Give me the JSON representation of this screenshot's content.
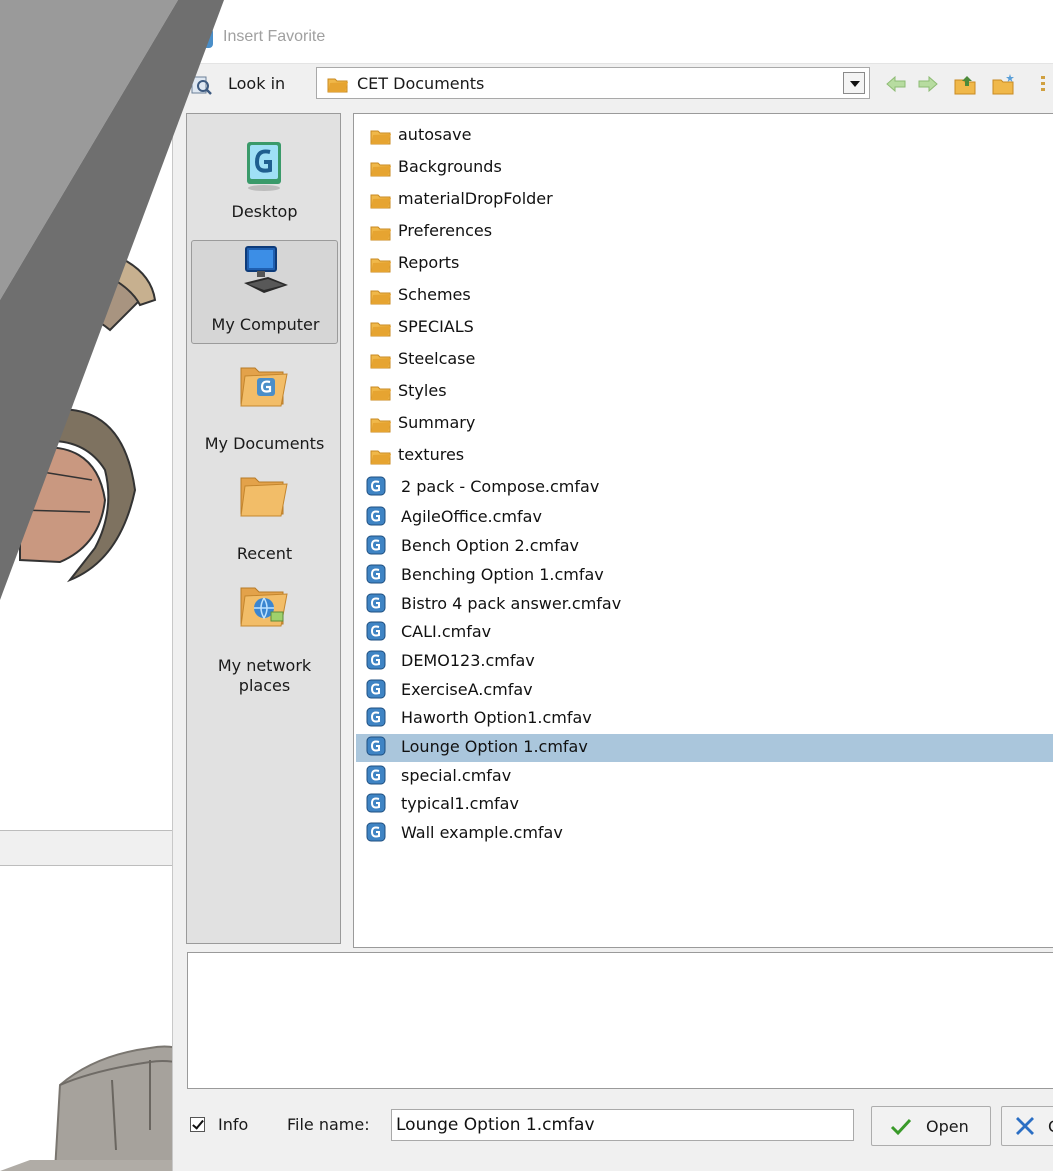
{
  "dialog": {
    "title": "Insert Favorite",
    "look_in_label": "Look in",
    "look_in_value": "CET Documents",
    "toolbar": {
      "back_icon": "arrow-left-icon",
      "forward_icon": "arrow-right-icon",
      "up_icon": "folder-up-icon",
      "new_folder_icon": "new-folder-icon",
      "view_icon": "view-menu-icon"
    }
  },
  "places": [
    {
      "label": "Desktop",
      "icon": "desktop-icon"
    },
    {
      "label": "My Computer",
      "icon": "computer-icon",
      "selected": true
    },
    {
      "label": "My Documents",
      "icon": "documents-folder-icon"
    },
    {
      "label": "Recent",
      "icon": "recent-folder-icon"
    },
    {
      "label": "My network places",
      "icon": "network-folder-icon"
    }
  ],
  "folders": [
    "autosave",
    "Backgrounds",
    "materialDropFolder",
    "Preferences",
    "Reports",
    "Schemes",
    "SPECIALS",
    "Steelcase",
    "Styles",
    "Summary",
    "textures"
  ],
  "files": [
    "2 pack - Compose.cmfav",
    "AgileOffice.cmfav",
    "Bench Option 2.cmfav",
    "Benching Option 1.cmfav",
    "Bistro 4 pack answer.cmfav",
    "CALI.cmfav",
    "DEMO123.cmfav",
    "ExerciseA.cmfav",
    "Haworth Option1.cmfav",
    "Lounge Option 1.cmfav",
    "special.cmfav",
    "typical1.cmfav",
    "Wall example.cmfav"
  ],
  "selected_file": "Lounge Option 1.cmfav",
  "bottom": {
    "info_label": "Info",
    "info_checked": true,
    "file_name_label": "File name:",
    "file_name_value": "Lounge Option 1.cmfav",
    "open_label": "Open",
    "cancel_label": "C"
  },
  "colors": {
    "selection": "#aac6dc",
    "folder": "#e8a53a",
    "overlay": "#6f6f6f",
    "title_text": "#a0a0a0"
  }
}
